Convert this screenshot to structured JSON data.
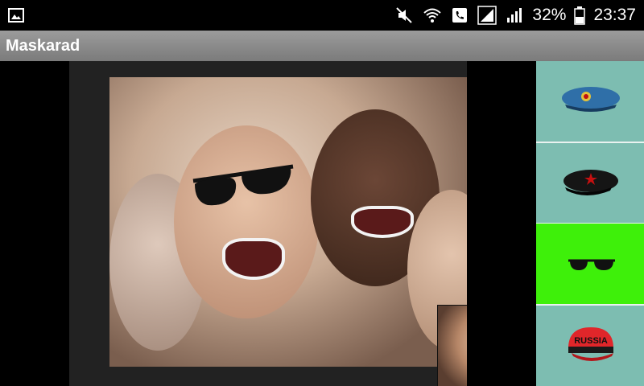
{
  "status_bar": {
    "battery_percent": "32%",
    "time": "23:37",
    "icons": [
      "gallery-icon",
      "mute-icon",
      "wifi-icon",
      "phone-call-icon",
      "signal-icon",
      "signal-icon",
      "battery-icon"
    ]
  },
  "app": {
    "title": "Maskarad"
  },
  "masks": [
    {
      "name": "blue-beret",
      "selected": false
    },
    {
      "name": "black-beret",
      "selected": false
    },
    {
      "name": "sunglasses",
      "selected": true
    },
    {
      "name": "red-cap",
      "selected": false,
      "text": "RUSSIA"
    }
  ],
  "colors": {
    "sidebar_bg": "#7dbdb1",
    "selected_bg": "#3ef00a",
    "titlebar": "#8a8a8a"
  }
}
